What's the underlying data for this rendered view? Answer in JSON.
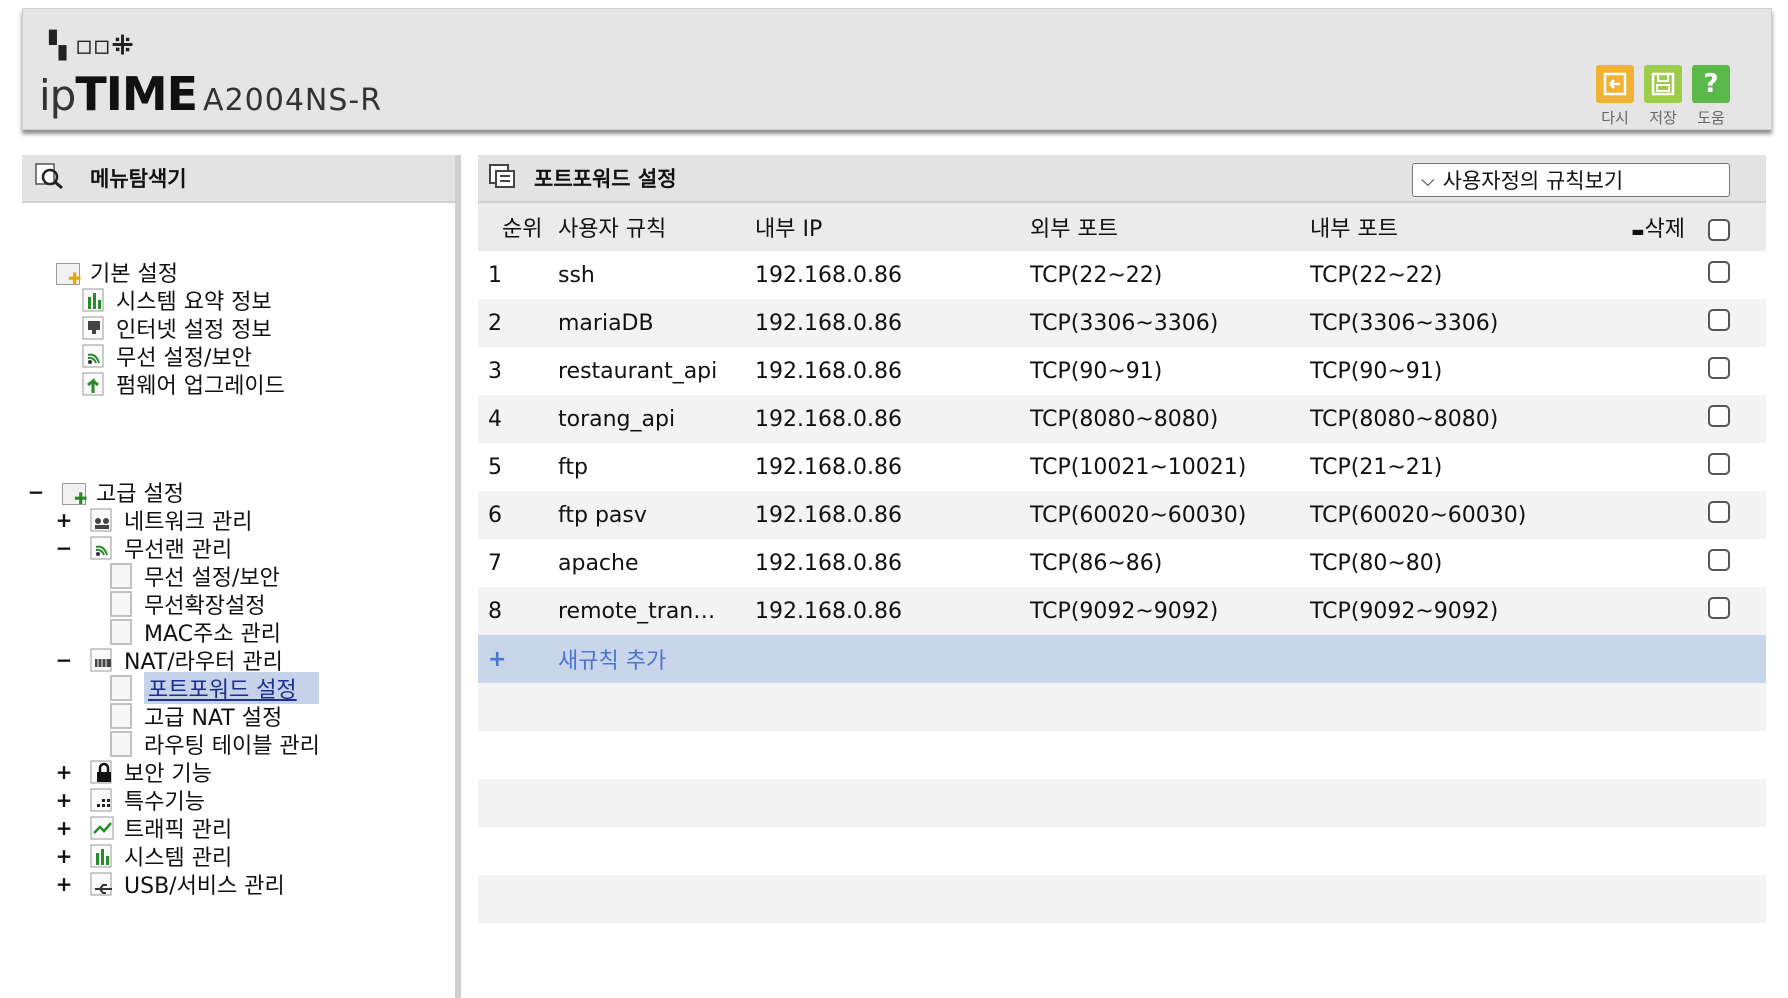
{
  "header": {
    "logo_dots": "▝▖◻◻⁜",
    "brand_prefix": "ip",
    "brand_bold": "TIME",
    "model": "A2004NS-R",
    "buttons": [
      {
        "label": "다시",
        "icon": "undo-icon",
        "color": "#f2b233"
      },
      {
        "label": "저장",
        "icon": "save-icon",
        "color": "#9ccc4a"
      },
      {
        "label": "도움",
        "icon": "help-icon",
        "color": "#5bb84a"
      }
    ]
  },
  "sidebar": {
    "title": "메뉴탐색기",
    "basic": {
      "label": "기본 설정",
      "items": [
        "시스템 요약 정보",
        "인터넷 설정 정보",
        "무선 설정/보안",
        "펌웨어 업그레이드"
      ]
    },
    "advanced": {
      "toggle": "−",
      "label": "고급 설정",
      "network": {
        "toggle": "+",
        "label": "네트워크 관리"
      },
      "wireless": {
        "toggle": "−",
        "label": "무선랜 관리",
        "items": [
          "무선 설정/보안",
          "무선확장설정",
          "MAC주소 관리"
        ]
      },
      "nat": {
        "toggle": "−",
        "label": "NAT/라우터 관리",
        "items": [
          "포트포워드 설정",
          "고급 NAT 설정",
          "라우팅 테이블 관리"
        ]
      },
      "others": [
        {
          "toggle": "+",
          "label": "보안 기능"
        },
        {
          "toggle": "+",
          "label": "특수기능"
        },
        {
          "toggle": "+",
          "label": "트래픽 관리"
        },
        {
          "toggle": "+",
          "label": "시스템 관리"
        },
        {
          "toggle": "+",
          "label": "USB/서비스 관리"
        }
      ]
    }
  },
  "main": {
    "title": "포트포워드 설정",
    "dropdown": "사용자정의 규칙보기",
    "columns": [
      "순위",
      "사용자 규칙",
      "내부 IP",
      "외부 포트",
      "내부 포트",
      "삭제"
    ],
    "rows": [
      [
        "1",
        "ssh",
        "192.168.0.86",
        "TCP(22~22)",
        "TCP(22~22)"
      ],
      [
        "2",
        "mariaDB",
        "192.168.0.86",
        "TCP(3306~3306)",
        "TCP(3306~3306)"
      ],
      [
        "3",
        "restaurant_api",
        "192.168.0.86",
        "TCP(90~91)",
        "TCP(90~91)"
      ],
      [
        "4",
        "torang_api",
        "192.168.0.86",
        "TCP(8080~8080)",
        "TCP(8080~8080)"
      ],
      [
        "5",
        "ftp",
        "192.168.0.86",
        "TCP(10021~10021)",
        "TCP(21~21)"
      ],
      [
        "6",
        "ftp pasv",
        "192.168.0.86",
        "TCP(60020~60030)",
        "TCP(60020~60030)"
      ],
      [
        "7",
        "apache",
        "192.168.0.86",
        "TCP(86~86)",
        "TCP(80~80)"
      ],
      [
        "8",
        "remote_tran…",
        "192.168.0.86",
        "TCP(9092~9092)",
        "TCP(9092~9092)"
      ]
    ],
    "add_label": "새규칙 추가",
    "add_icon": "+"
  }
}
